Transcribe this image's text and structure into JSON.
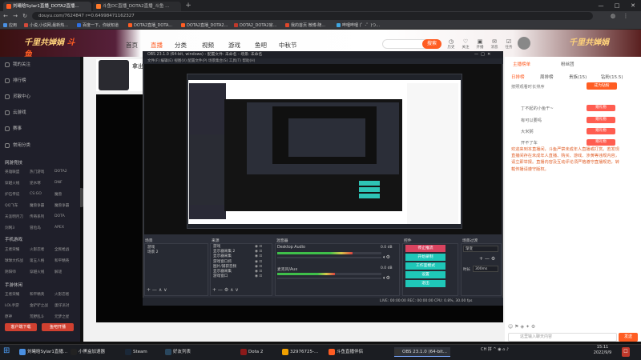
{
  "browser": {
    "tabs": [
      {
        "title": "刘曦晗Sylar1直播_DOTA2直播...",
        "active": true,
        "color": "#ff5d23"
      },
      {
        "title": "斗鱼DC直播_DOTA2直播_斗鱼 ...",
        "active": false,
        "color": "#ff7a2b"
      }
    ],
    "url": "douyu.com/7624847 r=0.64998471162327",
    "bookmarks": [
      {
        "label": "应用",
        "color": "#4a90e2"
      },
      {
        "label": "小说,小说网,最新热...",
        "color": "#d24a3a"
      },
      {
        "label": "百度一下，你就知道",
        "color": "#2f6fe0"
      },
      {
        "label": "DOTA2直播_DOTA...",
        "color": "#ff5d23"
      },
      {
        "label": "DOTA2直播_DOTA2...",
        "color": "#ff5d23"
      },
      {
        "label": "DOTA2_DOTA2官...",
        "color": "#c0392b"
      },
      {
        "label": "我的首页 微博-随...",
        "color": "#e0472b"
      },
      {
        "label": "哔哩哔哩 (゜-゜)つ...",
        "color": "#3fa6e0"
      }
    ]
  },
  "site": {
    "logo_text": "斗鱼",
    "banner_text": "千里共婵娟",
    "nav": [
      "首页",
      "直播",
      "分类",
      "视频",
      "游戏",
      "鱼吧",
      "中秋节"
    ],
    "nav_active": "直播",
    "search_placeholder": "",
    "search_button": "搜索",
    "header_icons": [
      {
        "icon": "history-icon",
        "label": "历史"
      },
      {
        "icon": "follow-icon",
        "label": "关注"
      },
      {
        "icon": "live-icon",
        "label": "开播"
      },
      {
        "icon": "message-icon",
        "label": "消息"
      },
      {
        "icon": "task-icon",
        "label": "任务"
      },
      {
        "icon": "avatar-icon",
        "label": ""
      }
    ]
  },
  "sidebar": {
    "items": [
      "我的关注",
      "排行榜",
      "灵敏中心",
      "云游戏",
      "赛事"
    ],
    "section_title": "常用分类",
    "section_title2": "网游竞技",
    "grid1": [
      [
        "英雄联盟",
        "热门游戏",
        "DOTA2"
      ],
      [
        "穿越火线",
        "逆水寒",
        "DNF"
      ],
      [
        "炉石传说",
        "CS:GO",
        "魔兽"
      ],
      [
        "QQ飞车",
        "魔兽争霸",
        "魔兽争霸"
      ],
      [
        "天涯明月刀",
        "传奇系列",
        "DOTA"
      ],
      [
        "剑网3",
        "冒险岛",
        "APEX"
      ]
    ],
    "section_title3": "手机游戏",
    "grid2": [
      [
        "王者荣耀",
        "火影忍者",
        "全民枪战"
      ],
      [
        "球球大作战",
        "第五人格",
        "和平精英"
      ],
      [
        "阴阳师",
        "穿越火线",
        "解谜"
      ]
    ],
    "section_title4": "手游休闲",
    "grid3": [
      [
        "王者荣耀",
        "和平精英",
        "火影忍者"
      ],
      [
        "LOL手游",
        "金铲铲之战",
        "蛋仔派对"
      ],
      [
        "原神",
        "荒野乱斗",
        "元梦之星"
      ]
    ],
    "btn_left": "客户端下载",
    "btn_right": "鱼吧开播"
  },
  "room": {
    "streamer_name": "拿出"
  },
  "obs": {
    "title": "OBS 23.1.0 (64-bit, windows) - 配置文件: 未命名 - 场景: 未命名",
    "menu": "文件(F)  编辑(E)  视图(V)  配置文件(P)  场景集合(S)  工具(T)  帮助(H)",
    "panels": {
      "scenes_title": "场景",
      "scenes": "游戏\n场景 2",
      "sources_title": "来源",
      "sources": "游戏\n显示器采集 2\n显示器采集\n游戏窗口抓\n图片/捕获音频\n显示器采集\n游戏窗口",
      "mixer_title": "混音器",
      "mixer": [
        {
          "name": "Desktop Audio",
          "db": "0.0 dB",
          "level": 0.72
        },
        {
          "name": "麦克风/Aux",
          "db": "0.0 dB",
          "level": 0.55
        }
      ],
      "transitions_title": "场景过渡",
      "transition_value": "渐变",
      "duration_label": "时长",
      "duration_value": "300ms",
      "controls_title": "控件",
      "controls": [
        "停止推流",
        "开始录制",
        "工作室模式",
        "设置",
        "退出"
      ]
    },
    "status": "LIVE: 00:00:00    REC: 00:00:00    CPU: 0.8%, 30.00 fps"
  },
  "chat": {
    "tabs": [
      "主播榜单",
      "粉丝团",
      "贵宾",
      "周榜"
    ],
    "sub_tabs": [
      "日排榜",
      "周排榜",
      "贵族(15)",
      "钻粉(15.5)"
    ],
    "ranking_label": "按照观看时长排序",
    "rank_button": "成为钻粉",
    "rank_rows": [
      {
        "name": "丁不起的小鱼干~",
        "btn": "赠礼物"
      },
      {
        "name": "有可以要吗",
        "btn": "赠礼物"
      },
      {
        "name": "大米粥",
        "btn": "赠礼物"
      },
      {
        "name": "开不了车",
        "btn": "赠礼物"
      }
    ],
    "notice": "欢迎来到本直播间，斗鱼严禁未成年人直播或打赏。若发现直播间存在未成年人直播、购买、游戏、涉黄等违规内容，请立即举报。直播内容及互动评论须严格遵守直播规范，转载传播请遵守版权。",
    "input_placeholder": "这里输入聊天内容",
    "send_label": "发送"
  },
  "taskbar": {
    "apps": [
      {
        "label": "刘曦晗Sylar1直播...",
        "color": "#4a90e2",
        "active": false
      },
      {
        "label": "小黑盒加速器",
        "color": "#222",
        "active": false
      },
      {
        "label": "Steam",
        "color": "#1b2838",
        "active": false
      },
      {
        "label": "好友列表",
        "color": "#2a475e",
        "active": false
      },
      {
        "label": "Dota 2",
        "color": "#8b1a1a",
        "active": false
      },
      {
        "label": "32976725-...",
        "color": "#f0a000",
        "active": false
      },
      {
        "label": "斗鱼直播伴侣",
        "color": "#ff5d23",
        "active": false
      },
      {
        "label": "OBS 23.1.0 (64-bit...",
        "color": "#333",
        "active": true
      }
    ],
    "tray": "CH  拼  ^  ◉  ⌂  ♪",
    "time": "15:11",
    "date": "2022/9/9"
  }
}
